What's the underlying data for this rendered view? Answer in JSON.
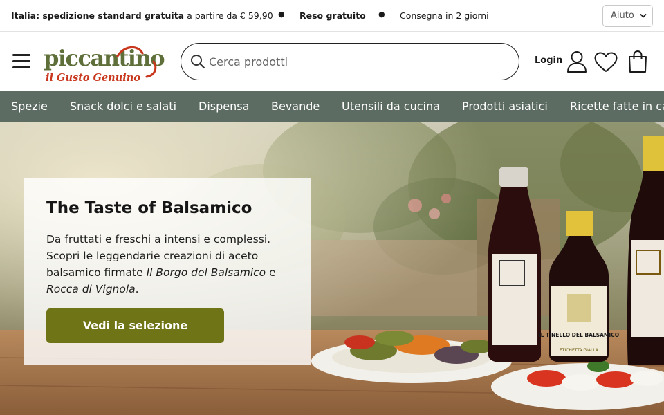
{
  "announcement": {
    "italy_label": "Italia: spedizione standard gratuita",
    "italy_suffix": "a partire da € 59,90",
    "returns": "Reso gratuito",
    "delivery": "Consegna in 2 giorni",
    "bullet": "●",
    "help_label": "Aiuto"
  },
  "header": {
    "logo_name": "piccantino",
    "logo_tagline": "il Gusto Genuino",
    "search_placeholder": "Cerca prodotti",
    "login_label": "Login",
    "icons": [
      "menu-icon",
      "search-icon",
      "user-icon",
      "heart-icon",
      "shopping-bag-icon"
    ]
  },
  "nav": {
    "items": [
      "Spezie",
      "Snack dolci e salati",
      "Dispensa",
      "Bevande",
      "Utensili da cucina",
      "Prodotti asiatici",
      "Ricette fatte in casa"
    ]
  },
  "hero": {
    "title": "The Taste of Balsamico",
    "text_start": "Da fruttati e freschi a intensi e complessi. Scopri le leggendarie creazioni di aceto balsamico firmate ",
    "brand1": "Il Borgo del Balsamico",
    "and": " e ",
    "brand2": "Rocca di Vignola",
    "text_end": ".",
    "cta_label": "Vedi la selezione",
    "bottle_label": "IL TINELLO DEL BALSAMICO",
    "bottle_sublabel": "ETICHETTA GIALLA"
  },
  "colors": {
    "nav_bg": "#5d6c63",
    "cta_bg": "#6f7416",
    "logo_red": "#c8361c",
    "logo_green": "#6a7a3a"
  }
}
